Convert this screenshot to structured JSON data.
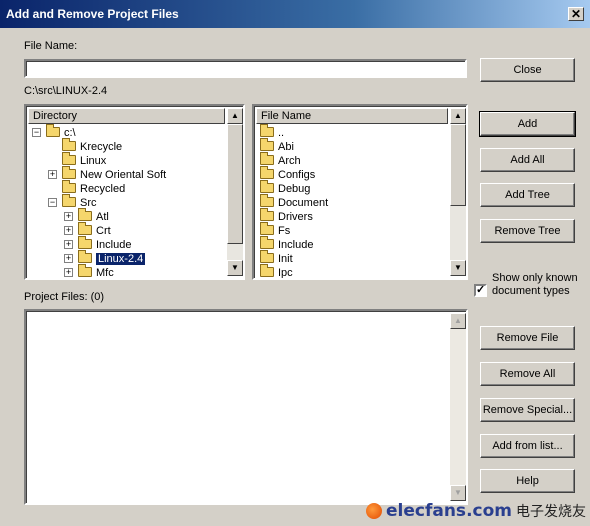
{
  "window": {
    "title": "Add and Remove Project Files",
    "close_glyph": "✕"
  },
  "file_name": {
    "label": "File Name:",
    "value": ""
  },
  "current_path": "C:\\src\\LINUX-2.4",
  "directory": {
    "header": "Directory",
    "items": [
      {
        "label": "c:\\",
        "expander": "−"
      },
      {
        "label": "Krecycle",
        "expander": ""
      },
      {
        "label": "Linux",
        "expander": ""
      },
      {
        "label": "New Oriental Soft",
        "expander": "+"
      },
      {
        "label": "Recycled",
        "expander": ""
      },
      {
        "label": "Src",
        "expander": "−"
      },
      {
        "label": "Atl",
        "expander": "+"
      },
      {
        "label": "Crt",
        "expander": "+"
      },
      {
        "label": "Include",
        "expander": "+"
      },
      {
        "label": "Linux-2.4",
        "expander": "+"
      },
      {
        "label": "Mfc",
        "expander": "+"
      }
    ]
  },
  "file_list": {
    "header": "File Name",
    "items": [
      "..",
      "Abi",
      "Arch",
      "Configs",
      "Debug",
      "Document",
      "Drivers",
      "Fs",
      "Include",
      "Init",
      "Ipc"
    ]
  },
  "project_files": {
    "label": "Project Files: (0)",
    "items": []
  },
  "buttons": {
    "close": "Close",
    "add": "Add",
    "add_all": "Add All",
    "add_tree": "Add Tree",
    "remove_tree": "Remove Tree",
    "remove_file": "Remove File",
    "remove_all": "Remove All",
    "remove_special": "Remove Special...",
    "add_from_list": "Add from list...",
    "help": "Help"
  },
  "show_only_known": {
    "label": "Show only known document types",
    "checked": true,
    "check_glyph": "✓"
  },
  "scroll_glyphs": {
    "up": "▲",
    "down": "▼"
  },
  "watermark": {
    "brand": "elecfans",
    "suffix": ".com",
    "cn": "电子发烧友"
  },
  "colors": {
    "selection": "#0a246a",
    "dialog_bg": "#d4d0c8",
    "title_bar": "#0a246a"
  }
}
